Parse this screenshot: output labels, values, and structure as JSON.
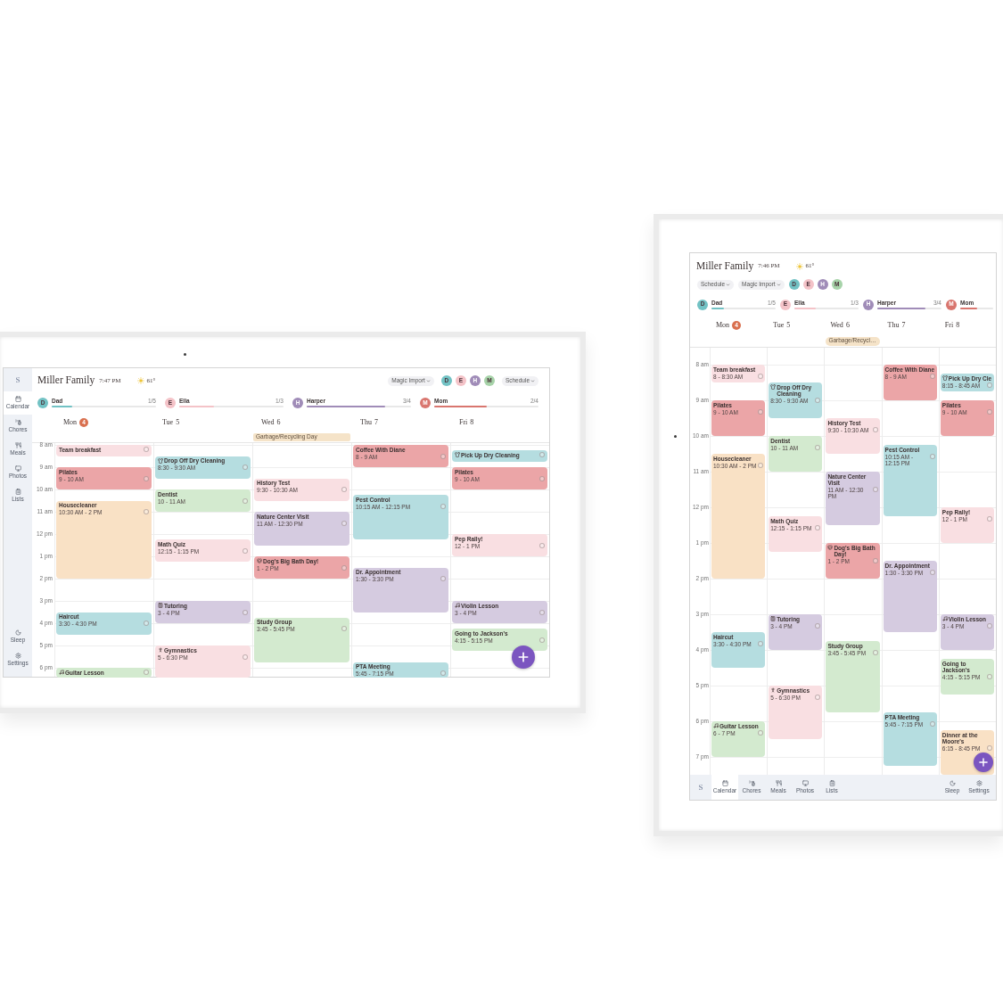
{
  "devices": [
    {
      "kind": "landscape",
      "logo": "S",
      "title": "Miller Family",
      "time": "7:47 PM",
      "temperature": "61°",
      "toolbar": [
        {
          "kind": "menu",
          "label": "Magic Import"
        },
        {
          "kind": "avatars",
          "avatars": [
            {
              "initial": "D",
              "color": "#72c2c4"
            },
            {
              "initial": "E",
              "color": "#f4c3c8"
            },
            {
              "initial": "H",
              "color": "#a08cb8"
            },
            {
              "initial": "M",
              "color": "#a7d3a9"
            }
          ]
        },
        {
          "kind": "menu",
          "label": "Schedule"
        }
      ],
      "nav": [
        {
          "label": "Calendar",
          "selected": true
        },
        {
          "label": "Chores",
          "selected": false
        },
        {
          "label": "Meals",
          "selected": false
        },
        {
          "label": "Photos",
          "selected": false
        },
        {
          "label": "Lists",
          "selected": false
        }
      ],
      "nav_bottom": [
        {
          "label": "Sleep",
          "selected": false
        },
        {
          "label": "Settings",
          "selected": false
        }
      ],
      "members": [
        {
          "initial": "D",
          "name": "Dad",
          "count": "1/5",
          "level": 0.2,
          "color": "#72c2c4"
        },
        {
          "initial": "E",
          "name": "Ella",
          "count": "1/3",
          "level": 0.33,
          "color": "#f4c3c8"
        },
        {
          "initial": "H",
          "name": "Harper",
          "count": "3/4",
          "level": 0.75,
          "color": "#a08cb8"
        },
        {
          "initial": "M",
          "name": "Mom",
          "count": "2/4",
          "level": 0.5,
          "color": "#d9766f"
        }
      ],
      "hours": [
        "8 am",
        "9 am",
        "10 am",
        "11 am",
        "12 pm",
        "1 pm",
        "2 pm",
        "3 pm",
        "4 pm",
        "5 pm",
        "6 pm"
      ],
      "days": [
        {
          "label": "Mon",
          "date": "4",
          "today": true,
          "events": [
            {
              "kind": "event",
              "title": "Team breakfast",
              "color": "#f9dfe2",
              "checked": false
            },
            {
              "kind": "event",
              "title": "Pilates",
              "time": "9 - 10 AM",
              "color": "#eba5a7",
              "checked": false
            },
            {
              "kind": "event",
              "title": "Housecleaner",
              "time": "10:30 AM - 2 PM",
              "color": "#f9e1c5",
              "checked": false
            },
            {
              "kind": "event",
              "title": "Haircut",
              "time": "3:30 - 4:30 PM",
              "color": "#b5dde0",
              "checked": false
            },
            {
              "kind": "music",
              "title": "Guitar Lesson",
              "color": "#d3eacf",
              "checked": false
            }
          ]
        },
        {
          "label": "Tue",
          "date": "5",
          "today": false,
          "events": [
            {
              "kind": "errand",
              "title": "Drop Off Dry Cleaning",
              "time": "8:30 - 9:30 AM",
              "color": "#b5dde0",
              "checked": false
            },
            {
              "kind": "event",
              "title": "Dentist",
              "time": "10 - 11 AM",
              "color": "#d3eacf",
              "checked": false
            },
            {
              "kind": "event",
              "title": "Math Quiz",
              "time": "12:15 - 1:15 PM",
              "color": "#f9dfe2",
              "checked": false
            },
            {
              "kind": "study",
              "title": "Tutoring",
              "time": "3 - 4 PM",
              "color": "#d5cbe0",
              "checked": false
            },
            {
              "kind": "sport",
              "title": "Gymnastics",
              "time": "5 - 6:30 PM",
              "color": "#f9dfe2",
              "checked": false
            }
          ]
        },
        {
          "label": "Wed",
          "date": "6",
          "today": false,
          "all_day": [
            {
              "title": "Garbage/Recycling Day",
              "color": "#f5e3c8"
            }
          ],
          "events": [
            {
              "kind": "event",
              "title": "History Test",
              "time": "9:30 - 10:30 AM",
              "color": "#f9dfe2",
              "checked": false
            },
            {
              "kind": "event",
              "title": "Nature Center Visit",
              "time": "11 AM - 12:30 PM",
              "color": "#d5cbe0",
              "checked": false
            },
            {
              "kind": "pet",
              "title": "Dog's Big Bath Day!",
              "time": "1 - 2 PM",
              "color": "#eba5a7",
              "checked": false
            },
            {
              "kind": "event",
              "title": "Study Group",
              "time": "3:45 - 5:45 PM",
              "color": "#d3eacf",
              "checked": false
            }
          ]
        },
        {
          "label": "Thu",
          "date": "7",
          "today": false,
          "events": [
            {
              "kind": "event",
              "title": "Coffee With Diane",
              "time": "8 - 9 AM",
              "color": "#eba5a7",
              "checked": false
            },
            {
              "kind": "event",
              "title": "Pest Control",
              "time": "10:15 AM - 12:15 PM",
              "color": "#b5dde0",
              "checked": false
            },
            {
              "kind": "event",
              "title": "Dr. Appointment",
              "time": "1:30 - 3:30 PM",
              "color": "#d5cbe0",
              "checked": false
            },
            {
              "kind": "event",
              "title": "PTA Meeting",
              "time": "5:45 - 7:15 PM",
              "color": "#b5dde0",
              "checked": false
            }
          ]
        },
        {
          "label": "Fri",
          "date": "8",
          "today": false,
          "events": [
            {
              "kind": "errand",
              "title": "Pick Up Dry Cleaning",
              "color": "#b5dde0",
              "checked": false
            },
            {
              "kind": "event",
              "title": "Pilates",
              "time": "9 - 10 AM",
              "color": "#eba5a7",
              "checked": false
            },
            {
              "kind": "event",
              "title": "Pep Rally!",
              "time": "12 - 1 PM",
              "color": "#f9dfe2",
              "checked": false
            },
            {
              "kind": "music",
              "title": "Violin Lesson",
              "time": "3 - 4 PM",
              "color": "#d5cbe0",
              "checked": false
            },
            {
              "kind": "event",
              "title": "Going to Jackson's",
              "time": "4:15 - 5:15 PM",
              "color": "#d3eacf",
              "checked": false
            }
          ]
        }
      ]
    },
    {
      "kind": "portrait",
      "logo": "S",
      "title": "Miller Family",
      "time": "7:46 PM",
      "temperature": "61°",
      "toolbar": [
        {
          "kind": "menu",
          "label": "Schedule"
        },
        {
          "kind": "menu",
          "label": "Magic Import"
        },
        {
          "kind": "avatars",
          "avatars": [
            {
              "initial": "D",
              "color": "#72c2c4"
            },
            {
              "initial": "E",
              "color": "#f4c3c8"
            },
            {
              "initial": "H",
              "color": "#a08cb8"
            },
            {
              "initial": "M",
              "color": "#a7d3a9"
            }
          ]
        }
      ],
      "nav": [
        {
          "label": "Calendar",
          "selected": true
        },
        {
          "label": "Chores",
          "selected": false
        },
        {
          "label": "Meals",
          "selected": false
        },
        {
          "label": "Photos",
          "selected": false
        },
        {
          "label": "Lists",
          "selected": false
        }
      ],
      "nav_bottom": [
        {
          "label": "Sleep",
          "selected": false
        },
        {
          "label": "Settings",
          "selected": false
        }
      ],
      "members": [
        {
          "initial": "D",
          "name": "Dad",
          "count": "1/5",
          "level": 0.2,
          "color": "#72c2c4"
        },
        {
          "initial": "E",
          "name": "Ella",
          "count": "1/3",
          "level": 0.33,
          "color": "#f4c3c8"
        },
        {
          "initial": "H",
          "name": "Harper",
          "count": "3/4",
          "level": 0.75,
          "color": "#a08cb8"
        },
        {
          "initial": "M",
          "name": "Mom",
          "level": 0.5,
          "color": "#d9766f"
        }
      ],
      "hours": [
        "8 am",
        "9 am",
        "10 am",
        "11 am",
        "12 pm",
        "1 pm",
        "2 pm",
        "3 pm",
        "4 pm",
        "5 pm",
        "6 pm",
        "7 pm"
      ],
      "days": [
        {
          "label": "Mon",
          "date": "4",
          "today": true,
          "events": [
            {
              "kind": "event",
              "title": "Team breakfast",
              "time": "8 - 8:30 AM",
              "color": "#f9dfe2",
              "checked": false
            },
            {
              "kind": "event",
              "title": "Pilates",
              "time": "9 - 10 AM",
              "color": "#eba5a7",
              "checked": false
            },
            {
              "kind": "event",
              "title": "Housecleaner",
              "time": "10:30 AM - 2 PM",
              "color": "#f9e1c5",
              "checked": false
            },
            {
              "kind": "event",
              "title": "Haircut",
              "time": "3:30 - 4:30 PM",
              "color": "#b5dde0",
              "checked": false
            },
            {
              "kind": "music",
              "title": "Guitar Lesson",
              "time": "6 - 7 PM",
              "color": "#d3eacf",
              "checked": false
            }
          ]
        },
        {
          "label": "Tue",
          "date": "5",
          "today": false,
          "events": [
            {
              "kind": "errand",
              "title": "Drop Off Dry Cleaning",
              "time": "8:30 - 9:30 AM",
              "color": "#b5dde0",
              "checked": false
            },
            {
              "kind": "event",
              "title": "Dentist",
              "time": "10 - 11 AM",
              "color": "#d3eacf",
              "checked": false
            },
            {
              "kind": "event",
              "title": "Math Quiz",
              "time": "12:15 - 1:15 PM",
              "color": "#f9dfe2",
              "checked": false
            },
            {
              "kind": "study",
              "title": "Tutoring",
              "time": "3 - 4 PM",
              "color": "#d5cbe0",
              "checked": false
            },
            {
              "kind": "sport",
              "title": "Gymnastics",
              "time": "5 - 6:30 PM",
              "color": "#f9dfe2",
              "checked": false
            }
          ]
        },
        {
          "label": "Wed",
          "date": "6",
          "today": false,
          "all_day": [
            {
              "title": "Garbage/Recycl…",
              "color": "#f5e3c8"
            }
          ],
          "events": [
            {
              "kind": "event",
              "title": "History Test",
              "time": "9:30 - 10:30 AM",
              "color": "#f9dfe2",
              "checked": false
            },
            {
              "kind": "event",
              "title": "Nature Center Visit",
              "time": "11 AM - 12:30 PM",
              "color": "#d5cbe0",
              "checked": false
            },
            {
              "kind": "pet",
              "title": "Dog's Big Bath Day!",
              "time": "1 - 2 PM",
              "color": "#eba5a7",
              "checked": false
            },
            {
              "kind": "event",
              "title": "Study Group",
              "time": "3:45 - 5:45 PM",
              "color": "#d3eacf",
              "checked": false
            }
          ]
        },
        {
          "label": "Thu",
          "date": "7",
          "today": false,
          "events": [
            {
              "kind": "event",
              "title": "Coffee With Diane",
              "time": "8 - 9 AM",
              "color": "#eba5a7",
              "checked": false
            },
            {
              "kind": "event",
              "title": "Pest Control",
              "time": "10:15 AM - 12:15 PM",
              "color": "#b5dde0",
              "checked": false
            },
            {
              "kind": "event",
              "title": "Dr. Appointment",
              "time": "1:30 - 3:30 PM",
              "color": "#d5cbe0",
              "checked": false
            },
            {
              "kind": "event",
              "title": "PTA Meeting",
              "time": "5:45 - 7:15 PM",
              "color": "#b5dde0",
              "checked": false
            }
          ]
        },
        {
          "label": "Fri",
          "date": "8",
          "today": false,
          "events": [
            {
              "kind": "errand",
              "title": "Pick Up Dry Cle",
              "time": "8:15 - 8:45 AM",
              "color": "#b5dde0",
              "checked": false
            },
            {
              "kind": "event",
              "title": "Pilates",
              "time": "9 - 10 AM",
              "color": "#eba5a7",
              "checked": false
            },
            {
              "kind": "event",
              "title": "Pep Rally!",
              "time": "12 - 1 PM",
              "color": "#f9dfe2",
              "checked": false
            },
            {
              "kind": "music",
              "title": "Violin Lesson",
              "time": "3 - 4 PM",
              "color": "#d5cbe0",
              "checked": false
            },
            {
              "kind": "event",
              "title": "Going to Jackson's",
              "time": "4:15 - 5:15 PM",
              "color": "#d3eacf",
              "checked": false
            },
            {
              "kind": "event",
              "title": "Dinner at the Moore's",
              "time": "6:15 - 8:45 PM",
              "color": "#f9e1c5",
              "checked": false
            }
          ]
        }
      ]
    }
  ]
}
